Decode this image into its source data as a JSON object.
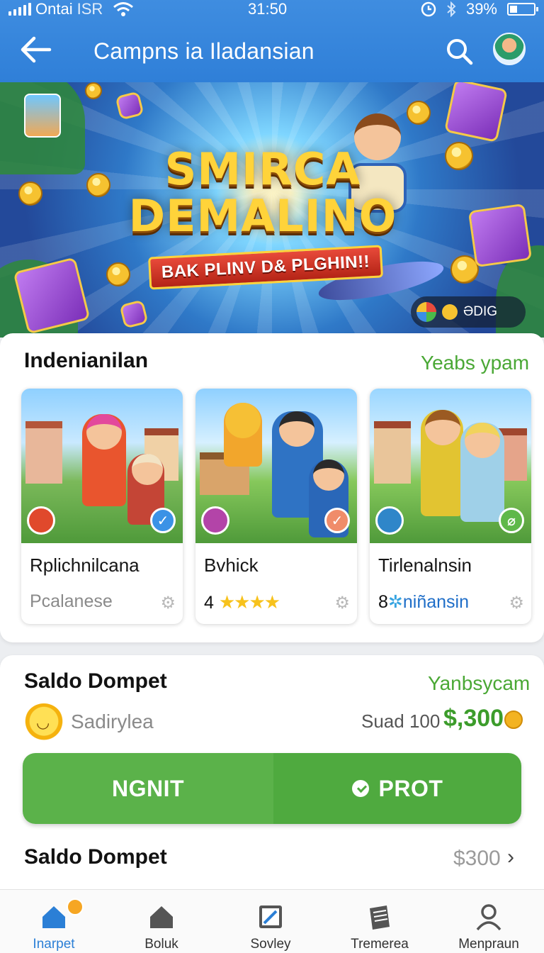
{
  "status_bar": {
    "carrier": "Ontai",
    "carrier_extra": "ISR",
    "time": "31:50",
    "battery": "39%"
  },
  "header": {
    "title": "Campns ia Iladansian"
  },
  "banner": {
    "title_line1": "SMIRCA",
    "title_line2": "DEMALINO",
    "ribbon": "BAK PLINV D& PLGHIN!!",
    "badge_text": "ƏDIG"
  },
  "games_section": {
    "title": "Indenianilan",
    "link": "Yeabs ypam",
    "cards": [
      {
        "name": "Rplichnilcana",
        "sub": "Pcalanese"
      },
      {
        "name": "Bvhick",
        "sub_prefix": "4",
        "stars": "★★★★"
      },
      {
        "name": "Tirlenalnsin",
        "sub_prefix": "8",
        "sub_blue": "niñansin"
      }
    ]
  },
  "wallet": {
    "title": "Saldo Dompet",
    "link": "Yanbsycam",
    "row_label": "Sadirylea",
    "amount_label": "Suad 100",
    "amount": "$,300",
    "button_left": "NGNIT",
    "button_right": "PROT",
    "row2_title": "Saldo Dompet",
    "row2_amount": "$300"
  },
  "bottom_nav": [
    {
      "label": "Inarpet"
    },
    {
      "label": "Boluk"
    },
    {
      "label": "Sovley"
    },
    {
      "label": "Tremerea"
    },
    {
      "label": "Menpraun"
    }
  ],
  "colors": {
    "header": "#2f7fd8",
    "accent_green": "#4faa3f",
    "link_green": "#4aa835",
    "nav_active": "#2b7fd6"
  }
}
